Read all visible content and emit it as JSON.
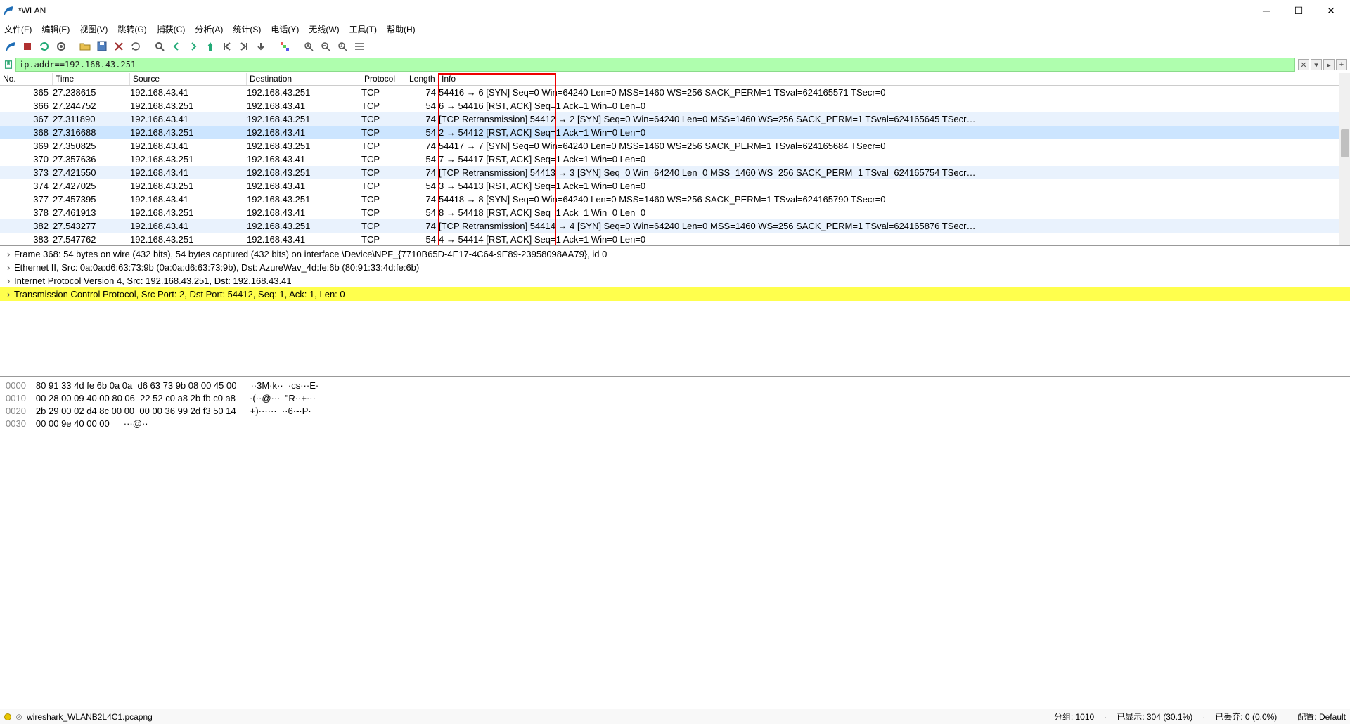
{
  "window": {
    "title": "*WLAN"
  },
  "menu": {
    "file": "文件(F)",
    "edit": "编辑(E)",
    "view": "视图(V)",
    "go": "跳转(G)",
    "capture": "捕获(C)",
    "analyze": "分析(A)",
    "statistics": "统计(S)",
    "telephony": "电话(Y)",
    "wireless": "无线(W)",
    "tools": "工具(T)",
    "help": "帮助(H)"
  },
  "filter": {
    "value": "ip.addr==192.168.43.251"
  },
  "columns": {
    "no": "No.",
    "time": "Time",
    "src": "Source",
    "dst": "Destination",
    "proto": "Protocol",
    "len": "Length",
    "info": "Info"
  },
  "packets": [
    {
      "no": "365",
      "time": "27.238615",
      "src": "192.168.43.41",
      "dst": "192.168.43.251",
      "proto": "TCP",
      "len": "74",
      "info": "54416 → 6 [SYN] Seq=0 Win=64240 Len=0 MSS=1460 WS=256 SACK_PERM=1 TSval=624165571 TSecr=0"
    },
    {
      "no": "366",
      "time": "27.244752",
      "src": "192.168.43.251",
      "dst": "192.168.43.41",
      "proto": "TCP",
      "len": "54",
      "info": "6 → 54416 [RST, ACK] Seq=1 Ack=1 Win=0 Len=0"
    },
    {
      "no": "367",
      "time": "27.311890",
      "src": "192.168.43.41",
      "dst": "192.168.43.251",
      "proto": "TCP",
      "len": "74",
      "info": "[TCP Retransmission] 54412 → 2 [SYN] Seq=0 Win=64240 Len=0 MSS=1460 WS=256 SACK_PERM=1 TSval=624165645 TSecr…",
      "retx": true
    },
    {
      "no": "368",
      "time": "27.316688",
      "src": "192.168.43.251",
      "dst": "192.168.43.41",
      "proto": "TCP",
      "len": "54",
      "info": "2 → 54412 [RST, ACK] Seq=1 Ack=1 Win=0 Len=0",
      "sel": true
    },
    {
      "no": "369",
      "time": "27.350825",
      "src": "192.168.43.41",
      "dst": "192.168.43.251",
      "proto": "TCP",
      "len": "74",
      "info": "54417 → 7 [SYN] Seq=0 Win=64240 Len=0 MSS=1460 WS=256 SACK_PERM=1 TSval=624165684 TSecr=0"
    },
    {
      "no": "370",
      "time": "27.357636",
      "src": "192.168.43.251",
      "dst": "192.168.43.41",
      "proto": "TCP",
      "len": "54",
      "info": "7 → 54417 [RST, ACK] Seq=1 Ack=1 Win=0 Len=0"
    },
    {
      "no": "373",
      "time": "27.421550",
      "src": "192.168.43.41",
      "dst": "192.168.43.251",
      "proto": "TCP",
      "len": "74",
      "info": "[TCP Retransmission] 54413 → 3 [SYN] Seq=0 Win=64240 Len=0 MSS=1460 WS=256 SACK_PERM=1 TSval=624165754 TSecr…",
      "retx": true
    },
    {
      "no": "374",
      "time": "27.427025",
      "src": "192.168.43.251",
      "dst": "192.168.43.41",
      "proto": "TCP",
      "len": "54",
      "info": "3 → 54413 [RST, ACK] Seq=1 Ack=1 Win=0 Len=0"
    },
    {
      "no": "377",
      "time": "27.457395",
      "src": "192.168.43.41",
      "dst": "192.168.43.251",
      "proto": "TCP",
      "len": "74",
      "info": "54418 → 8 [SYN] Seq=0 Win=64240 Len=0 MSS=1460 WS=256 SACK_PERM=1 TSval=624165790 TSecr=0"
    },
    {
      "no": "378",
      "time": "27.461913",
      "src": "192.168.43.251",
      "dst": "192.168.43.41",
      "proto": "TCP",
      "len": "54",
      "info": "8 → 54418 [RST, ACK] Seq=1 Ack=1 Win=0 Len=0"
    },
    {
      "no": "382",
      "time": "27.543277",
      "src": "192.168.43.41",
      "dst": "192.168.43.251",
      "proto": "TCP",
      "len": "74",
      "info": "[TCP Retransmission] 54414 → 4 [SYN] Seq=0 Win=64240 Len=0 MSS=1460 WS=256 SACK_PERM=1 TSval=624165876 TSecr…",
      "retx": true
    },
    {
      "no": "383",
      "time": "27.547762",
      "src": "192.168.43.251",
      "dst": "192.168.43.41",
      "proto": "TCP",
      "len": "54",
      "info": "4 → 54414 [RST, ACK] Seq=1 Ack=1 Win=0 Len=0"
    }
  ],
  "details": [
    {
      "text": "Frame 368: 54 bytes on wire (432 bits), 54 bytes captured (432 bits) on interface \\Device\\NPF_{7710B65D-4E17-4C64-9E89-23958098AA79}, id 0"
    },
    {
      "text": "Ethernet II, Src: 0a:0a:d6:63:73:9b (0a:0a:d6:63:73:9b), Dst: AzureWav_4d:fe:6b (80:91:33:4d:fe:6b)"
    },
    {
      "text": "Internet Protocol Version 4, Src: 192.168.43.251, Dst: 192.168.43.41"
    },
    {
      "text": "Transmission Control Protocol, Src Port: 2, Dst Port: 54412, Seq: 1, Ack: 1, Len: 0",
      "hl": true
    }
  ],
  "hex": [
    {
      "off": "0000",
      "bytes": "80 91 33 4d fe 6b 0a 0a  d6 63 73 9b 08 00 45 00",
      "ascii": "··3M·k··  ·cs···E·"
    },
    {
      "off": "0010",
      "bytes": "00 28 00 09 40 00 80 06  22 52 c0 a8 2b fb c0 a8",
      "ascii": "·(··@···  \"R··+···"
    },
    {
      "off": "0020",
      "bytes": "2b 29 00 02 d4 8c 00 00  00 00 36 99 2d f3 50 14",
      "ascii": "+)······  ··6·-·P·"
    },
    {
      "off": "0030",
      "bytes": "00 00 9e 40 00 00",
      "ascii": "···@··"
    }
  ],
  "status": {
    "file": "wireshark_WLANB2L4C1.pcapng",
    "packets": "分组: 1010",
    "displayed": "已显示: 304 (30.1%)",
    "dropped": "已丢弃: 0 (0.0%)",
    "profile": "配置: Default"
  }
}
